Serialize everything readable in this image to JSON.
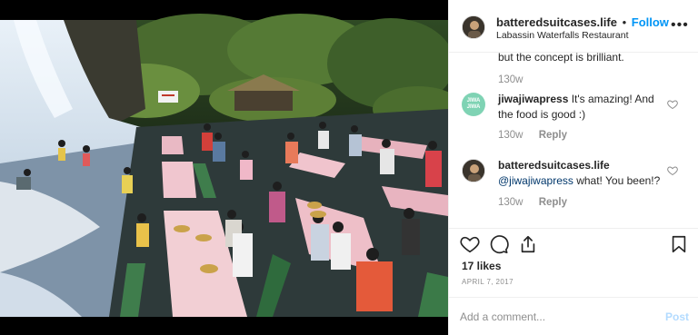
{
  "header": {
    "username": "batteredsuitcases.life",
    "separator": "•",
    "follow_label": "Follow",
    "location": "Labassin Waterfalls Restaurant",
    "more_icon": "ellipsis-icon",
    "more_glyph": "•••"
  },
  "comments": {
    "truncated_line": "but the concept is brilliant.",
    "truncated_time": "130w",
    "items": [
      {
        "username": "jiwajiwapress",
        "avatar_text": "JIWA JIWA",
        "text": " It's amazing! And the food is good :)",
        "time": "130w",
        "reply_label": "Reply"
      },
      {
        "username": "batteredsuitcases.life",
        "mention": "@jiwajiwapress",
        "text": " what! You been!?",
        "time": "130w",
        "reply_label": "Reply"
      }
    ]
  },
  "actions": {
    "like_icon": "heart-icon",
    "comment_icon": "comment-bubble-icon",
    "share_icon": "share-icon",
    "save_icon": "bookmark-icon"
  },
  "likes_text": "17 likes",
  "date_text": "APRIL 7, 2017",
  "add_comment": {
    "placeholder": "Add a comment...",
    "post_label": "Post"
  },
  "colors": {
    "accent": "#0095f6",
    "post_disabled": "#b3dbff",
    "muted": "#8e8e8e",
    "jiwa_avatar": "#7fd3b4"
  }
}
